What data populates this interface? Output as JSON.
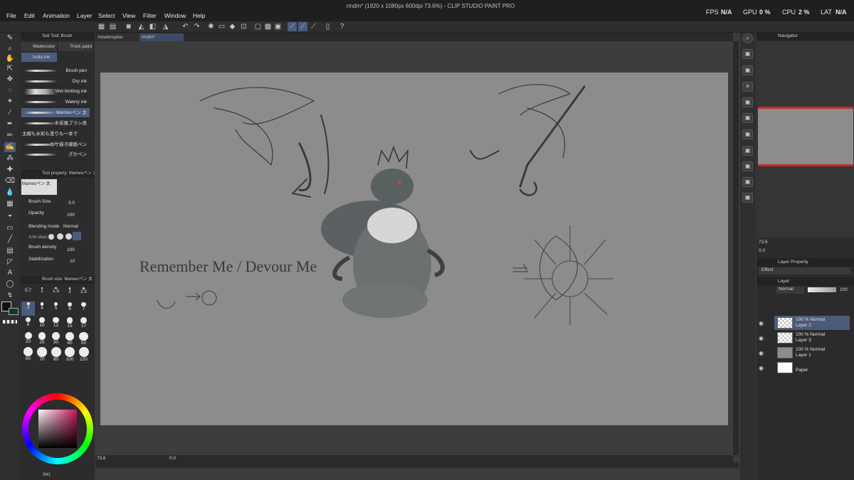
{
  "app": {
    "title": "rmdm* (1920 x 1080px 600dpi 73.6%) - CLIP STUDIO PAINT PRO"
  },
  "menu": [
    "File",
    "Edit",
    "Animation",
    "Layer",
    "Select",
    "View",
    "Filter",
    "Window",
    "Help"
  ],
  "stats": {
    "fps_label": "FPS",
    "fps_value": "N/A",
    "gpu_label": "GPU",
    "gpu_value": "0 %",
    "cpu_label": "CPU",
    "cpu_value": "2 %",
    "lat_label": "LAT",
    "lat_value": "N/A"
  },
  "tabs": [
    "howlerspike",
    "rmdm*"
  ],
  "subtool": {
    "header": "Sub Tool: Brush",
    "groups": [
      "Watercolor",
      "Thick paint",
      "India ink"
    ],
    "brushes": [
      "Brush pen",
      "Dry ink",
      "Wet blotting ink",
      "Watery ink",
      "Mameoペン 太",
      "木炭風ブラシ改",
      "主線も水彩も塗りも一本で",
      "ガサ描き線画ペン",
      "ざかペン"
    ]
  },
  "toolprop": {
    "header": "Tool property: Mameoペン 太",
    "preview_label": "Mameoペン 太",
    "brush_size_label": "Brush Size",
    "brush_size_value": "3.0",
    "opacity_label": "Opacity",
    "opacity_value": "100",
    "blending_label": "Blending mode",
    "blending_value": "Normal",
    "antialias_label": "Anti-alias",
    "density_label": "Brush density",
    "density_value": "100",
    "stabilization_label": "Stabilization",
    "stabilization_value": "10"
  },
  "brushsize": {
    "header": "Brush size: Mameoペン 太",
    "sizes": [
      "0.7",
      "1",
      "1.5",
      "2",
      "2.5",
      "3",
      "4",
      "5",
      "6",
      "7",
      "8",
      "10",
      "12",
      "15",
      "17",
      "20",
      "25",
      "30",
      "40",
      "50",
      "60",
      "70",
      "80",
      "100",
      "120"
    ]
  },
  "canvas": {
    "text": "Remember Me / Devour Me",
    "zoom": "73.6",
    "angle": "0.0"
  },
  "navigator": {
    "header": "Navigator",
    "zoom": "73.6",
    "angle": "0.0"
  },
  "layerprop": {
    "header": "Layer Property",
    "effect_label": "Effect"
  },
  "layers": {
    "header": "Layer",
    "blend": "Normal",
    "opacity": "100",
    "items": [
      {
        "mode": "100 % Normal",
        "name": "Layer 2"
      },
      {
        "mode": "100 % Normal",
        "name": "Layer 3"
      },
      {
        "mode": "100 % Normal",
        "name": "Layer 1"
      },
      {
        "mode": "",
        "name": "Paper"
      }
    ]
  },
  "colors": {
    "accent": "#4b5c7d",
    "paper": "#8c8c8c",
    "wheel_hue": "#c2185b"
  },
  "statusbar": {
    "count": "341"
  }
}
